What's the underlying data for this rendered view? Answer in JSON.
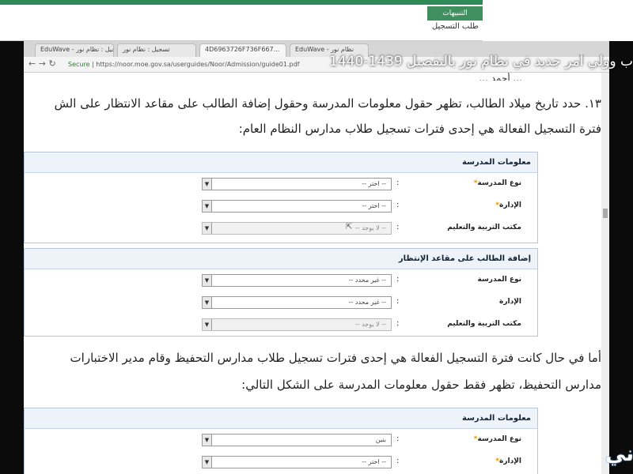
{
  "top_page": {
    "notifications_label": "التنبيهات",
    "registration_request": "طلب التسجيل"
  },
  "browser": {
    "tabs": [
      {
        "label": "EduWave - تسجيل : نظام نور"
      },
      {
        "label": "تسجيل : نظام نور"
      },
      {
        "label": "4D6963726F736F667..."
      },
      {
        "label": "EduWave - نظام نور"
      }
    ],
    "secure_label": "Secure",
    "url": "https://noor.moe.gov.sa/userguides/Noor/Admission/guide01.pdf"
  },
  "video_title": "ب وولي أمر جديد في نظام نور بالتفصيل 1439-1440",
  "document": {
    "cut_top_text": "... أحمد ...",
    "para_13": "١٣. حدد تاريخ ميلاد الطالب، تظهر حقول معلومات المدرسة وحقول إضافة الطالب على مقاعد الانتظار على الش",
    "para_13b": "فترة التسجيل الفعالة هي إحدى فترات تسجيل طلاب مدارس النظام العام:",
    "para_else": "أما في حال كانت فترة التسجيل الفعالة هي إحدى فترات تسجيل طلاب مدارس التحفيظ وقام مدير الاختبارات",
    "para_else_b": "مدارس التحفيظ، تظهر فقط حقول معلومات المدرسة على الشكل التالي:"
  },
  "form_school_info": {
    "title": "معلومات المدرسة",
    "rows": [
      {
        "label": "نوع المدرسة",
        "required": "*",
        "value": "-- اختر --"
      },
      {
        "label": "الإدارة",
        "required": "*",
        "value": "-- اختر --"
      },
      {
        "label": "مكتب التربية والتعليم",
        "required": "",
        "value": "-- لا يوجد --"
      }
    ]
  },
  "form_waiting": {
    "title": "إضافة الطالب على مقاعد الإنتظار",
    "rows": [
      {
        "label": "نوع المدرسة",
        "value": "-- غير محدد --"
      },
      {
        "label": "الإدارة",
        "value": "-- غير محدد --"
      },
      {
        "label": "مكتب التربية والتعليم",
        "value": "-- لا يوجد --"
      }
    ]
  },
  "form_school_info_2": {
    "title": "معلومات المدرسة",
    "rows": [
      {
        "label": "نوع المدرسة",
        "required": "*",
        "value": "بنين"
      },
      {
        "label": "الإدارة",
        "required": "*",
        "value": "-- اختر --"
      }
    ]
  },
  "colon": ":",
  "logo_text": "ني"
}
